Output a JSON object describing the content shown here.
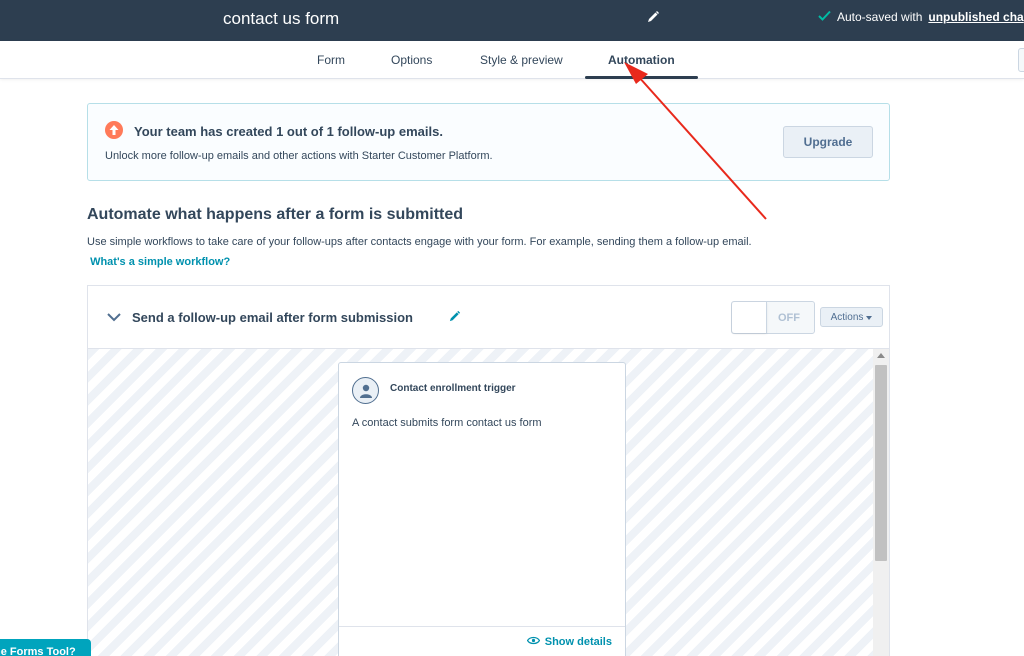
{
  "topbar": {
    "title": "contact us form",
    "autosave_prefix": "Auto-saved with",
    "autosave_link": "unpublished cha"
  },
  "tabs": [
    {
      "label": "Form",
      "active": false
    },
    {
      "label": "Options",
      "active": false
    },
    {
      "label": "Style & preview",
      "active": false
    },
    {
      "label": "Automation",
      "active": true
    }
  ],
  "banner": {
    "headline": "Your team has created 1 out of 1 follow-up emails.",
    "subtext": "Unlock more follow-up emails and other actions with Starter Customer Platform.",
    "button": "Upgrade"
  },
  "section": {
    "title": "Automate what happens after a form is submitted",
    "description": "Use simple workflows to take care of your follow-ups after contacts engage with your form. For example, sending them a follow-up email.",
    "link": "What's a simple workflow?"
  },
  "workflow": {
    "title": "Send a follow-up email after form submission",
    "toggle_label": "OFF",
    "actions_label": "Actions",
    "trigger": {
      "title": "Contact enrollment trigger",
      "description": "A contact submits form contact us form",
      "show_details": "Show details"
    }
  },
  "help_tab": {
    "label": "he Forms Tool?"
  },
  "colors": {
    "topbar": "#2d3e50",
    "accent_link": "#0091ae",
    "upgrade_icon": "#ff7a59",
    "annotation_arrow": "#e8291c"
  }
}
